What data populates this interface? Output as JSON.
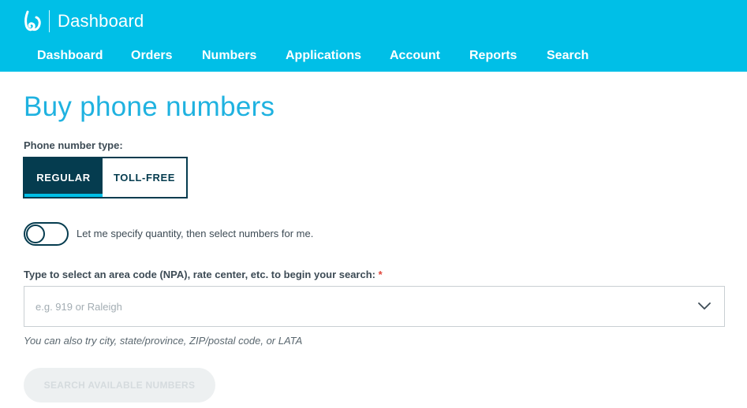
{
  "header": {
    "title": "Dashboard",
    "logo_icon": "bandwidth-logo-icon",
    "background_color": "#00bfe7"
  },
  "nav": {
    "items": [
      {
        "label": "Dashboard"
      },
      {
        "label": "Orders"
      },
      {
        "label": "Numbers"
      },
      {
        "label": "Applications"
      },
      {
        "label": "Account"
      },
      {
        "label": "Reports"
      },
      {
        "label": "Search"
      }
    ]
  },
  "page": {
    "title": "Buy phone numbers"
  },
  "number_type": {
    "label": "Phone number type:",
    "options": [
      "REGULAR",
      "TOLL-FREE"
    ],
    "selected": "REGULAR"
  },
  "quantity_toggle": {
    "label": "Let me specify quantity, then select numbers for me.",
    "on": false
  },
  "search": {
    "label": "Type to select an area code (NPA), rate center, etc. to begin your search:",
    "required_mark": "*",
    "placeholder": "e.g. 919 or Raleigh",
    "value": "",
    "hint": "You can also try city, state/province, ZIP/postal code, or LATA",
    "dropdown_icon": "chevron-down-icon"
  },
  "actions": {
    "search_button": "SEARCH AVAILABLE NUMBERS",
    "search_button_enabled": false
  },
  "colors": {
    "accent": "#00bfe7",
    "title": "#1fb2e0",
    "dark": "#053c4f",
    "required": "#e0453a"
  }
}
